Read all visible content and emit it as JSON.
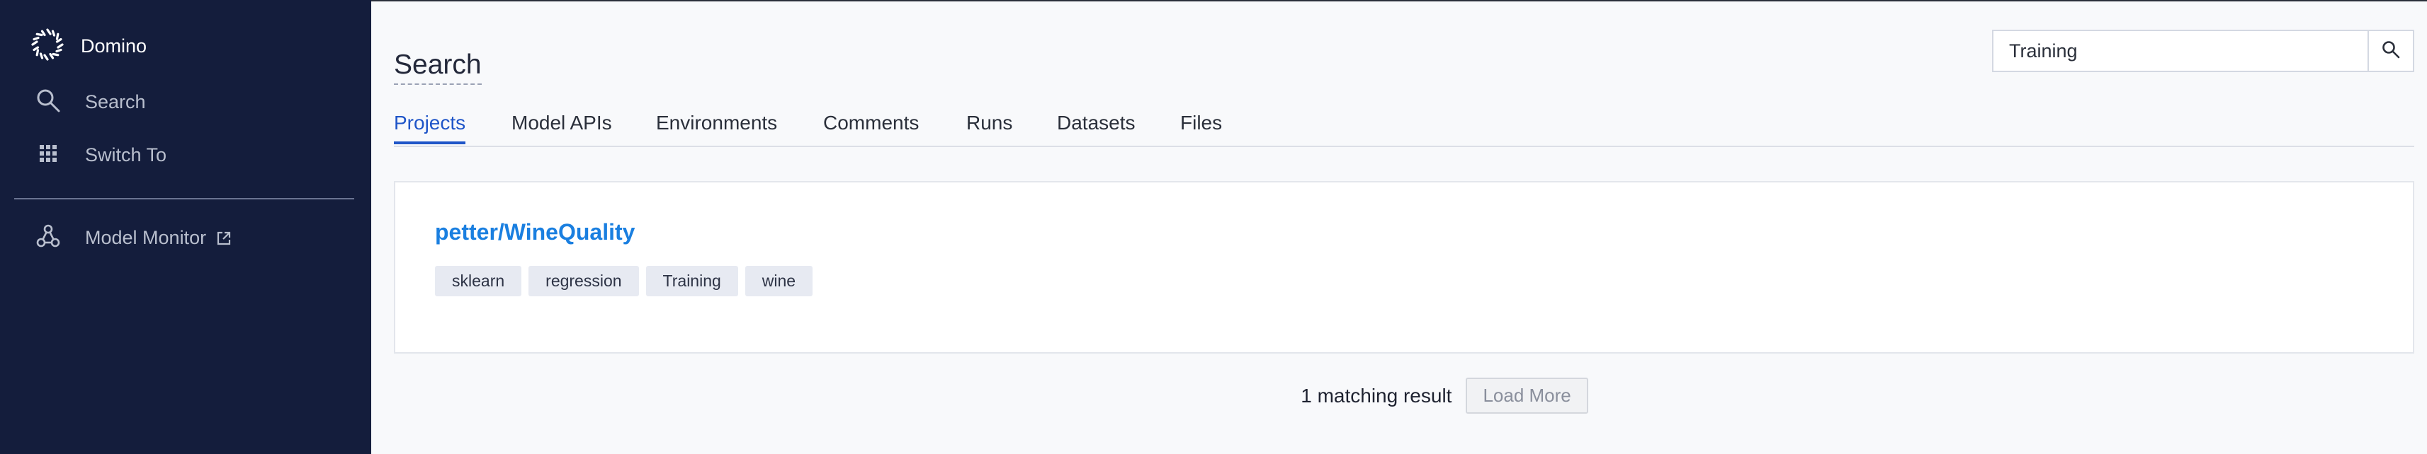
{
  "app": {
    "brand": "Domino"
  },
  "sidebar": {
    "items": [
      {
        "label": "Search",
        "icon": "search-icon"
      },
      {
        "label": "Switch To",
        "icon": "grid-icon"
      },
      {
        "label": "Model Monitor",
        "icon": "model-monitor-icon",
        "external": true
      }
    ]
  },
  "page": {
    "title": "Search"
  },
  "search": {
    "value": "Training"
  },
  "tabs": [
    {
      "label": "Projects",
      "active": true
    },
    {
      "label": "Model APIs"
    },
    {
      "label": "Environments"
    },
    {
      "label": "Comments"
    },
    {
      "label": "Runs"
    },
    {
      "label": "Datasets"
    },
    {
      "label": "Files"
    }
  ],
  "results": [
    {
      "title": "petter/WineQuality",
      "tags": [
        "sklearn",
        "regression",
        "Training",
        "wine"
      ]
    }
  ],
  "footer": {
    "count_text": "1 matching result",
    "load_more": "Load More"
  },
  "colors": {
    "sidebar_bg": "#141d3c",
    "accent": "#1f55c8",
    "link": "#1a7fe0"
  }
}
